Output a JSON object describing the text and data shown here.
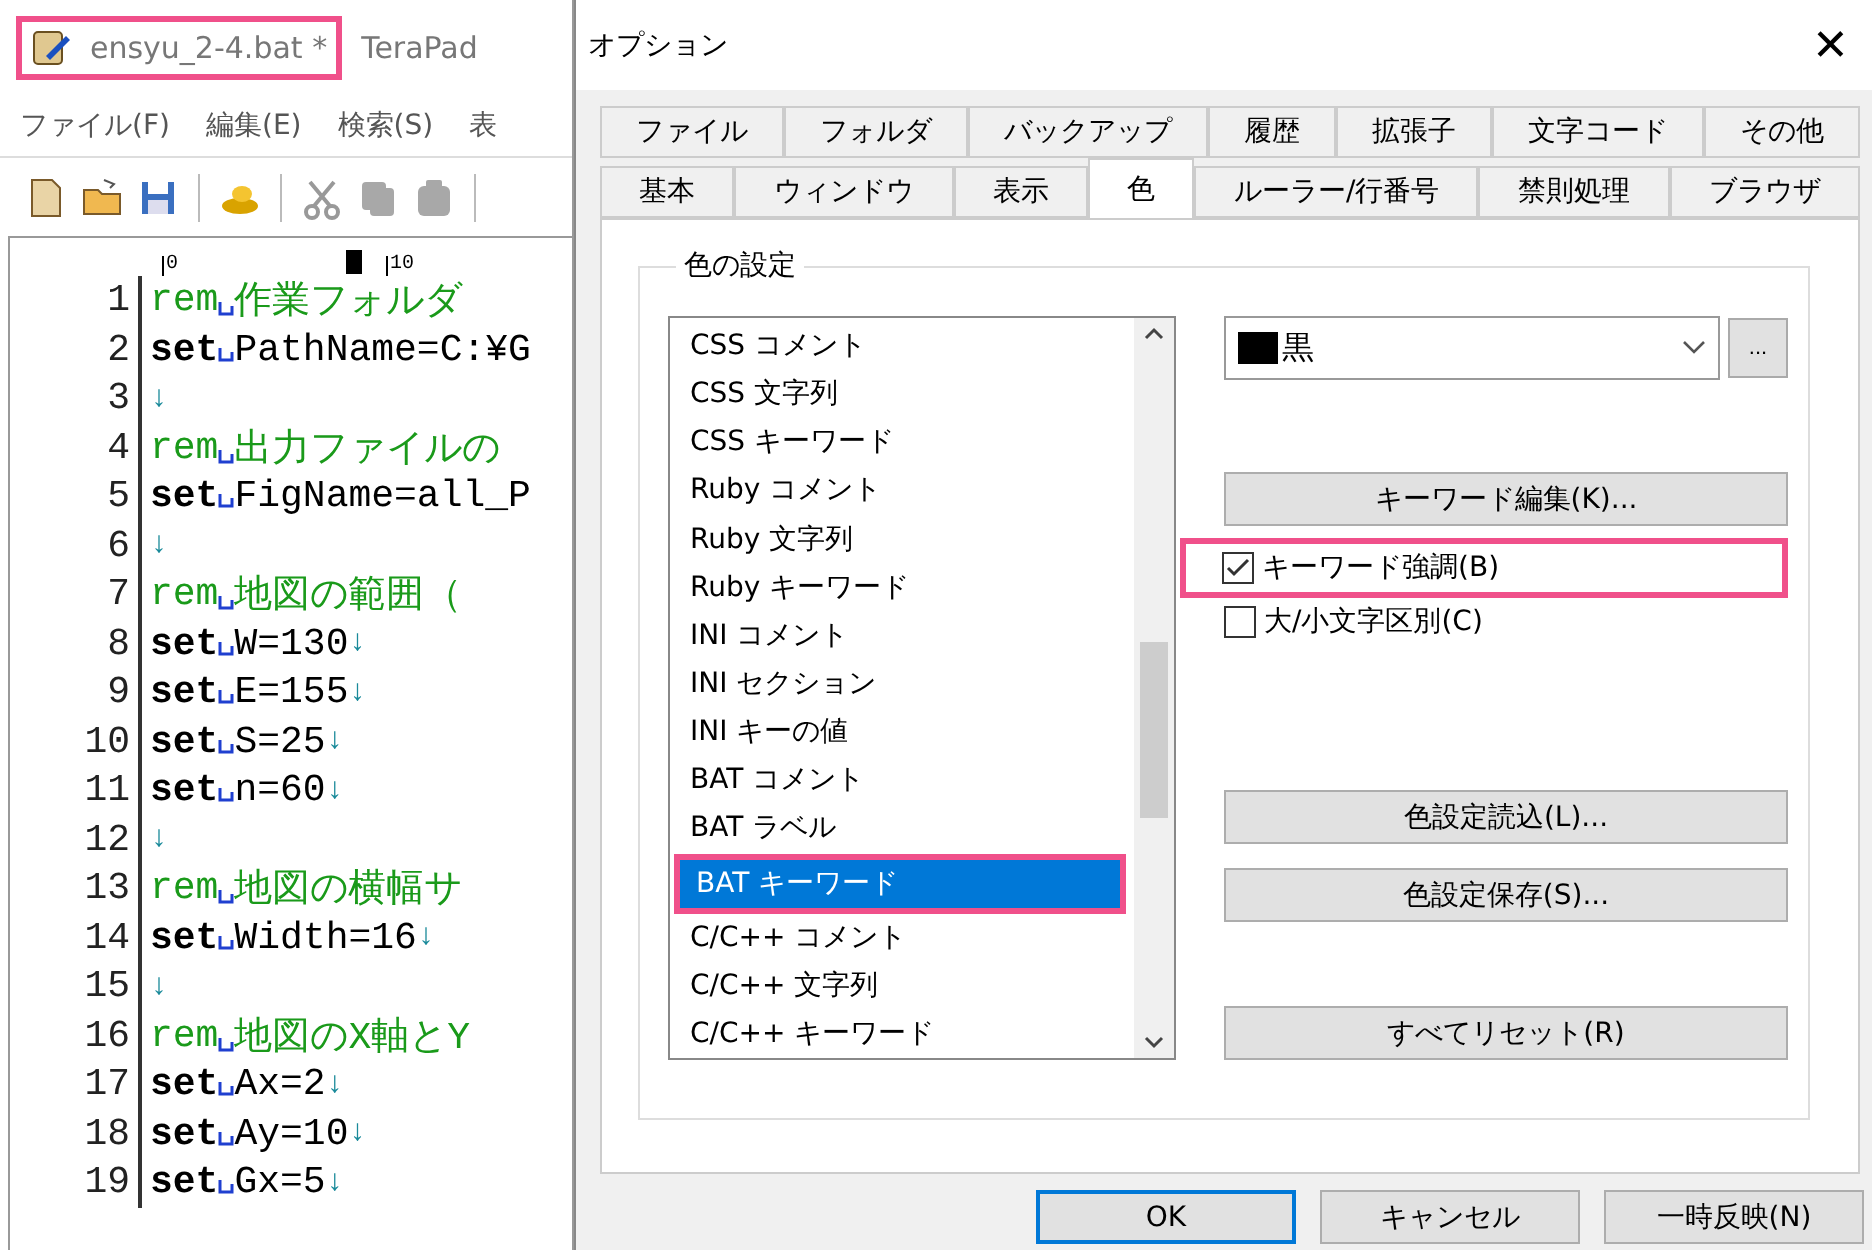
{
  "editor": {
    "title": {
      "file": "ensyu_2-4.bat *",
      "app": "TeraPad",
      "highlighted": true
    },
    "menu": [
      "ファイル(F)",
      "編集(E)",
      "検索(S)",
      "表"
    ],
    "ruler": [
      "0",
      "10"
    ],
    "lines": [
      {
        "number": "1",
        "kind": "rem",
        "keyword": "rem",
        "text": "作業フォルダ"
      },
      {
        "number": "2",
        "kind": "set",
        "keyword": "set",
        "text": "PathName=C:¥G"
      },
      {
        "number": "3",
        "kind": "blank",
        "eol": "↓"
      },
      {
        "number": "4",
        "kind": "rem",
        "keyword": "rem",
        "text": "出力ファイルの"
      },
      {
        "number": "5",
        "kind": "set",
        "keyword": "set",
        "text": "FigName=all_P"
      },
      {
        "number": "6",
        "kind": "blank",
        "eol": "↓"
      },
      {
        "number": "7",
        "kind": "rem",
        "keyword": "rem",
        "text": "地図の範囲（"
      },
      {
        "number": "8",
        "kind": "set",
        "keyword": "set",
        "text": "W=130",
        "eol": "↓"
      },
      {
        "number": "9",
        "kind": "set",
        "keyword": "set",
        "text": "E=155",
        "eol": "↓"
      },
      {
        "number": "10",
        "kind": "set",
        "keyword": "set",
        "text": "S=25",
        "eol": "↓"
      },
      {
        "number": "11",
        "kind": "set",
        "keyword": "set",
        "text": "n=60",
        "eol": "↓"
      },
      {
        "number": "12",
        "kind": "blank",
        "eol": "↓"
      },
      {
        "number": "13",
        "kind": "rem",
        "keyword": "rem",
        "text": "地図の横幅サ"
      },
      {
        "number": "14",
        "kind": "set",
        "keyword": "set",
        "text": "Width=16",
        "eol": "↓"
      },
      {
        "number": "15",
        "kind": "blank",
        "eol": "↓"
      },
      {
        "number": "16",
        "kind": "rem",
        "keyword": "rem",
        "text": "地図のX軸とY"
      },
      {
        "number": "17",
        "kind": "set",
        "keyword": "set",
        "text": "Ax=2",
        "eol": "↓"
      },
      {
        "number": "18",
        "kind": "set",
        "keyword": "set",
        "text": "Ay=10",
        "eol": "↓"
      },
      {
        "number": "19",
        "kind": "set",
        "keyword": "set",
        "text": "Gx=5",
        "eol": "↓"
      }
    ]
  },
  "dialog": {
    "title": "オプション",
    "close": "✕",
    "tab_rows": [
      [
        {
          "label": "ファイル",
          "selected": false
        },
        {
          "label": "フォルダ",
          "selected": false
        },
        {
          "label": "バックアップ",
          "selected": false
        },
        {
          "label": "履歴",
          "selected": false
        },
        {
          "label": "拡張子",
          "selected": false
        },
        {
          "label": "文字コード",
          "selected": false
        },
        {
          "label": "その他",
          "selected": false
        }
      ],
      [
        {
          "label": "基本",
          "selected": false
        },
        {
          "label": "ウィンドウ",
          "selected": false
        },
        {
          "label": "表示",
          "selected": false
        },
        {
          "label": "色",
          "selected": true
        },
        {
          "label": "ルーラー/行番号",
          "selected": false
        },
        {
          "label": "禁則処理",
          "selected": false
        },
        {
          "label": "ブラウザ",
          "selected": false
        }
      ]
    ],
    "group_title": "色の設定",
    "items": [
      {
        "label": "CSS コメント",
        "selected": false,
        "highlighted": false
      },
      {
        "label": "CSS 文字列",
        "selected": false,
        "highlighted": false
      },
      {
        "label": "CSS キーワード",
        "selected": false,
        "highlighted": false
      },
      {
        "label": "Ruby コメント",
        "selected": false,
        "highlighted": false
      },
      {
        "label": "Ruby 文字列",
        "selected": false,
        "highlighted": false
      },
      {
        "label": "Ruby キーワード",
        "selected": false,
        "highlighted": false
      },
      {
        "label": "INI コメント",
        "selected": false,
        "highlighted": false
      },
      {
        "label": "INI セクション",
        "selected": false,
        "highlighted": false
      },
      {
        "label": "INI キーの値",
        "selected": false,
        "highlighted": false
      },
      {
        "label": "BAT コメント",
        "selected": false,
        "highlighted": false
      },
      {
        "label": "BAT ラベル",
        "selected": false,
        "highlighted": false
      },
      {
        "label": "BAT キーワード",
        "selected": true,
        "highlighted": true
      },
      {
        "label": "C/C++ コメント",
        "selected": false,
        "highlighted": false
      },
      {
        "label": "C/C++ 文字列",
        "selected": false,
        "highlighted": false
      },
      {
        "label": "C/C++ キーワード",
        "selected": false,
        "highlighted": false
      }
    ],
    "color_select": {
      "value": "黒",
      "color": "#000000",
      "more": "..."
    },
    "keyword_button": "キーワード編集(K)...",
    "checkboxes": [
      {
        "label": "キーワード強調(B)",
        "checked": true,
        "highlighted": true
      },
      {
        "label": "大/小文字区別(C)",
        "checked": false,
        "highlighted": false
      }
    ],
    "file_buttons": [
      "色設定読込(L)...",
      "色設定保存(S)..."
    ],
    "reset_button": "すべてリセット(R)",
    "footer_buttons": [
      {
        "label": "OK",
        "default": true
      },
      {
        "label": "キャンセル",
        "default": false
      },
      {
        "label": "一時反映(N)",
        "default": false
      }
    ]
  }
}
